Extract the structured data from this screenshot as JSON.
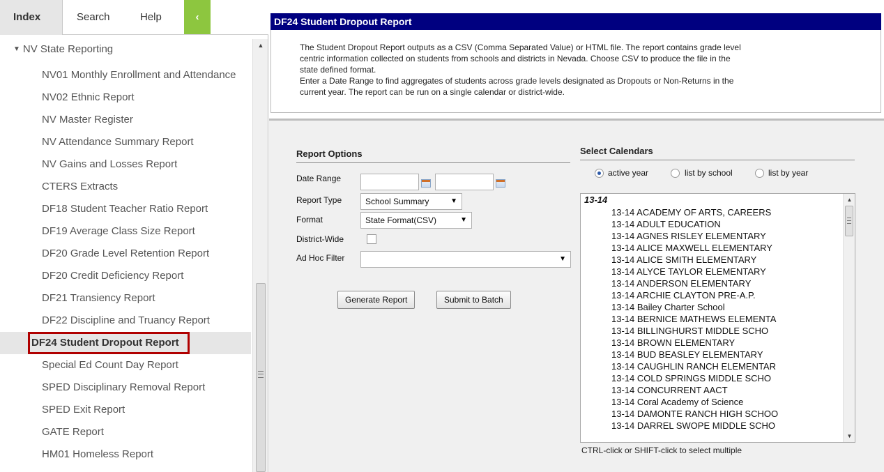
{
  "nav": {
    "tabs": {
      "index": "Index",
      "search": "Search",
      "help": "Help",
      "collapse": "‹"
    },
    "folder": "NV State Reporting",
    "items": [
      {
        "label": "NV01 Monthly Enrollment and Attendance"
      },
      {
        "label": "NV02 Ethnic Report"
      },
      {
        "label": "NV Master Register"
      },
      {
        "label": "NV Attendance Summary Report"
      },
      {
        "label": "NV Gains and Losses Report"
      },
      {
        "label": "CTERS Extracts"
      },
      {
        "label": "DF18 Student Teacher Ratio Report"
      },
      {
        "label": "DF19 Average Class Size Report"
      },
      {
        "label": "DF20 Grade Level Retention Report"
      },
      {
        "label": "DF20 Credit Deficiency Report"
      },
      {
        "label": "DF21 Transiency Report"
      },
      {
        "label": "DF22 Discipline and Truancy Report"
      },
      {
        "label": "DF24 Student Dropout Report",
        "selected": true
      },
      {
        "label": "Special Ed Count Day Report"
      },
      {
        "label": "SPED Disciplinary Removal Report"
      },
      {
        "label": "SPED Exit Report"
      },
      {
        "label": "GATE Report"
      },
      {
        "label": "HM01 Homeless Report"
      }
    ]
  },
  "main": {
    "title": "DF24 Student Dropout Report",
    "description": [
      "The Student Dropout Report outputs as a CSV (Comma Separated Value) or HTML file. The report contains grade level",
      "centric information collected on students from schools and districts in Nevada. Choose CSV to produce the file in the",
      "state defined format.",
      "Enter a Date Range to find aggregates of students across grade levels designated as Dropouts or Non-Returns in the",
      "current year. The report can be run on a single calendar or district-wide."
    ],
    "report_options": {
      "heading": "Report Options",
      "date_range_label": "Date Range",
      "date_from": "",
      "date_to": "",
      "report_type_label": "Report Type",
      "report_type_value": "School Summary",
      "format_label": "Format",
      "format_value": "State Format(CSV)",
      "district_wide_label": "District-Wide",
      "district_wide_checked": false,
      "ad_hoc_label": "Ad Hoc Filter",
      "ad_hoc_value": "",
      "generate_button": "Generate Report",
      "batch_button": "Submit to Batch"
    },
    "calendars": {
      "heading": "Select Calendars",
      "radio_active": "active year",
      "radio_school": "list by school",
      "radio_year": "list by year",
      "selected_radio": "active year",
      "year_group": "13-14",
      "items": [
        "13-14 ACADEMY OF ARTS, CAREERS",
        "13-14 ADULT EDUCATION",
        "13-14 AGNES RISLEY ELEMENTARY",
        "13-14 ALICE MAXWELL ELEMENTARY",
        "13-14 ALICE SMITH ELEMENTARY",
        "13-14 ALYCE TAYLOR ELEMENTARY",
        "13-14 ANDERSON ELEMENTARY",
        "13-14 ARCHIE CLAYTON PRE-A.P.",
        "13-14 Bailey Charter School",
        "13-14 BERNICE MATHEWS ELEMENTA",
        "13-14 BILLINGHURST MIDDLE SCHO",
        "13-14 BROWN ELEMENTARY",
        "13-14 BUD BEASLEY ELEMENTARY",
        "13-14 CAUGHLIN RANCH ELEMENTAR",
        "13-14 COLD SPRINGS MIDDLE SCHO",
        "13-14 CONCURRENT AACT",
        "13-14 Coral Academy of Science",
        "13-14 DAMONTE RANCH HIGH SCHOO",
        "13-14 DARREL SWOPE MIDDLE SCHO"
      ],
      "hint": "CTRL-click or SHIFT-click to select multiple"
    }
  },
  "colors": {
    "title_bar": "#000080",
    "collapse_button": "#8dc63f",
    "selected_outline": "#b00000"
  }
}
